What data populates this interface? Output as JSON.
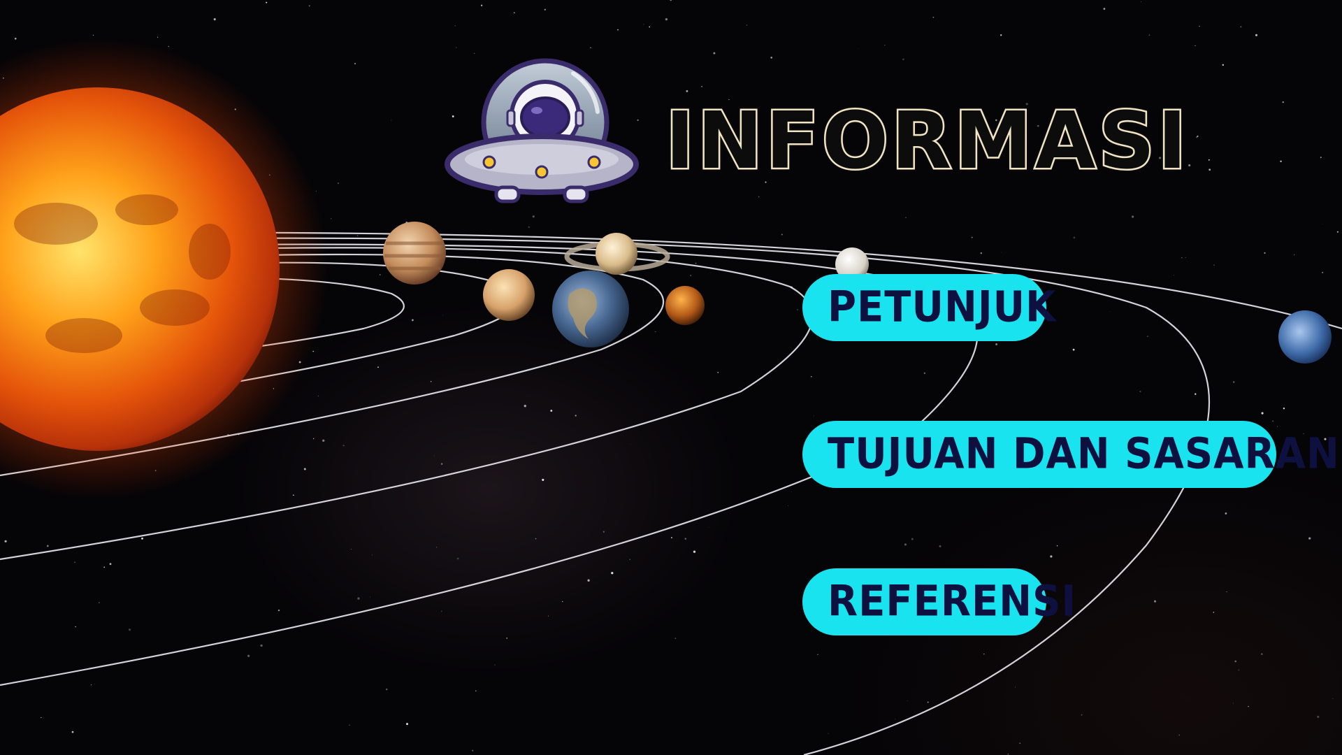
{
  "page": {
    "title": "INFORMASI"
  },
  "menu": {
    "items": [
      {
        "id": "petunjuk",
        "label": "PETUNJUK"
      },
      {
        "id": "tujuan",
        "label": "TUJUAN DAN SASARAN"
      },
      {
        "id": "referensi",
        "label": "REFERENSI"
      }
    ]
  },
  "colors": {
    "button_bg": "#19e3ee",
    "button_text": "#0e1040",
    "title_outline": "#efe4c4",
    "background": "#050407"
  },
  "icons": {
    "mascot": "astronaut-ufo-icon"
  }
}
